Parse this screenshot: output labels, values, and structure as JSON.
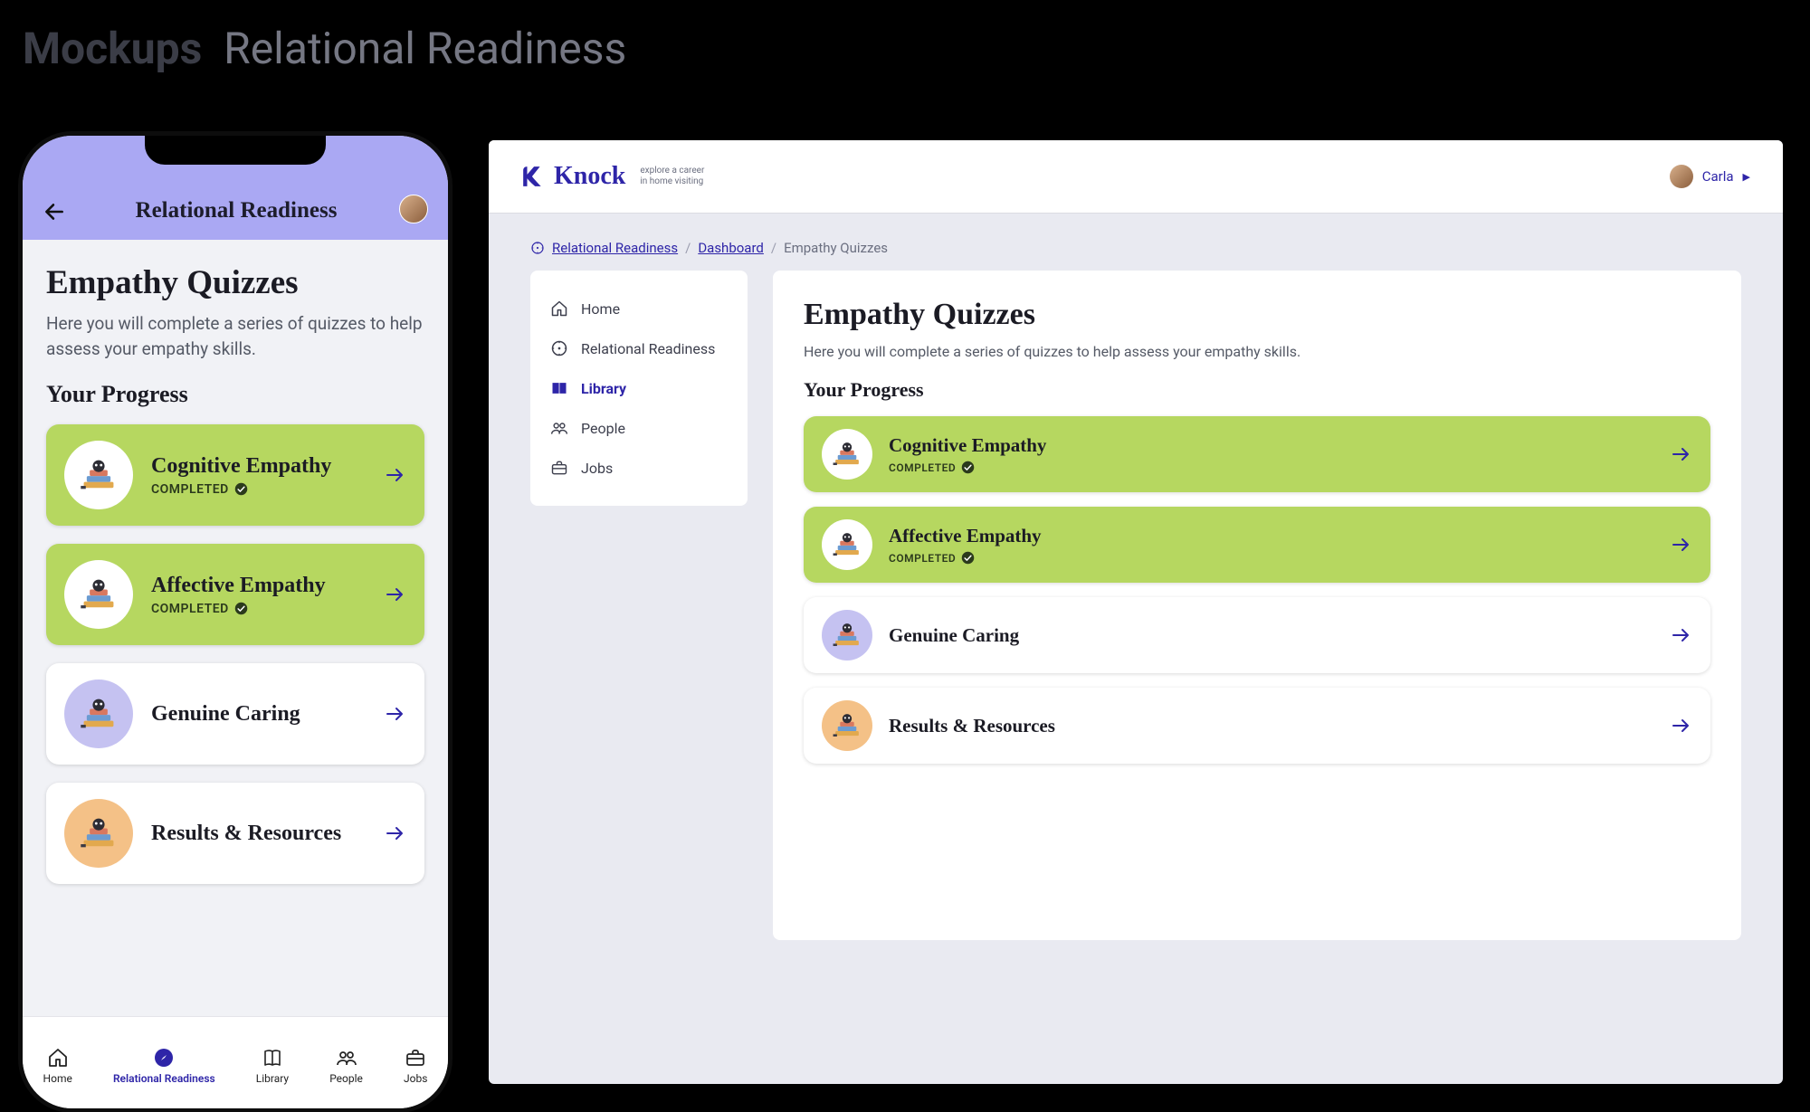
{
  "slide": {
    "title_bold": "Mockups",
    "title_rest": "Relational Readiness"
  },
  "brand": {
    "name": "Knock",
    "tagline": "explore a career\nin home visiting"
  },
  "user": {
    "name": "Carla"
  },
  "breadcrumb": {
    "items": [
      "Relational Readiness",
      "Dashboard",
      "Empathy Quizzes"
    ]
  },
  "sidebar": {
    "items": [
      {
        "label": "Home",
        "icon": "home-icon"
      },
      {
        "label": "Relational Readiness",
        "icon": "compass-icon"
      },
      {
        "label": "Library",
        "icon": "book-icon",
        "active": true
      },
      {
        "label": "People",
        "icon": "people-icon"
      },
      {
        "label": "Jobs",
        "icon": "briefcase-icon"
      }
    ]
  },
  "mobile": {
    "header_title": "Relational Readiness",
    "tabs": [
      {
        "label": "Home",
        "icon": "home-icon"
      },
      {
        "label": "Relational Readiness",
        "icon": "compass-icon",
        "active": true
      },
      {
        "label": "Library",
        "icon": "book-icon"
      },
      {
        "label": "People",
        "icon": "people-icon"
      },
      {
        "label": "Jobs",
        "icon": "briefcase-icon"
      }
    ]
  },
  "page": {
    "title": "Empathy Quizzes",
    "description": "Here you will complete a series of quizzes to help assess your empathy skills.",
    "progress_heading": "Your Progress",
    "status_completed": "COMPLETED"
  },
  "quizzes": [
    {
      "title": "Cognitive Empathy",
      "completed": true,
      "circle": "white"
    },
    {
      "title": "Affective Empathy",
      "completed": true,
      "circle": "white"
    },
    {
      "title": "Genuine Caring",
      "completed": false,
      "circle": "lilac"
    },
    {
      "title": "Results & Resources",
      "completed": false,
      "circle": "orange"
    }
  ],
  "colors": {
    "indigo": "#2e25a8",
    "lavender": "#aaa8f3",
    "green": "#b6d760",
    "orange": "#f4c187",
    "lilac": "#c5c2f1"
  }
}
